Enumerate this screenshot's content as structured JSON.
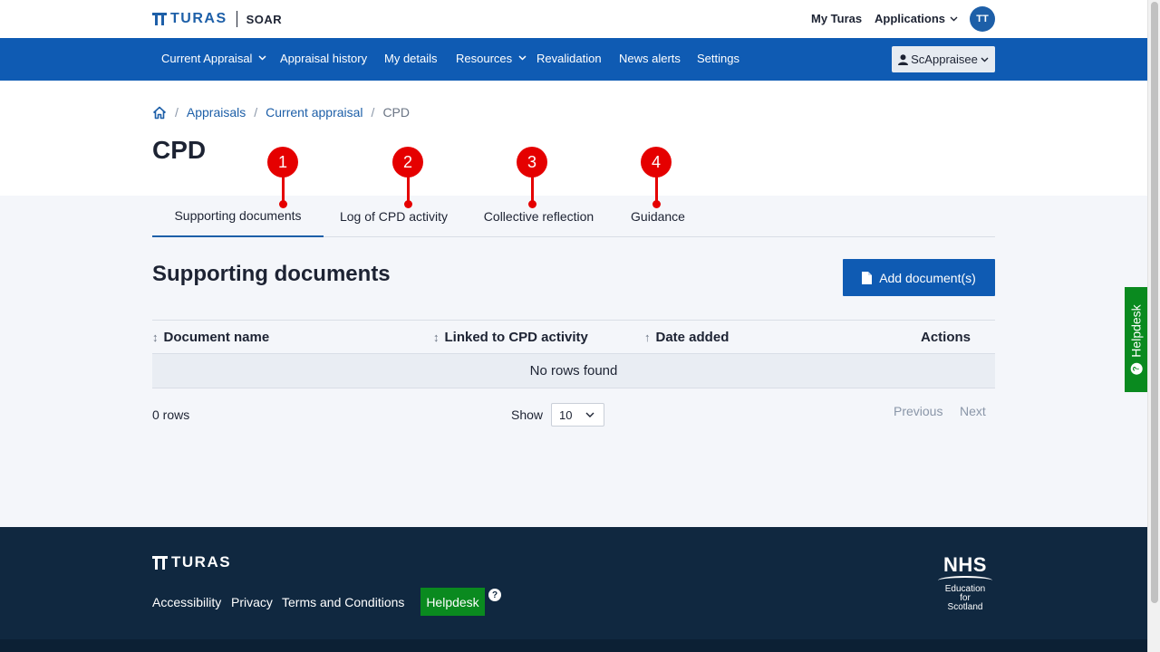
{
  "header": {
    "logo_text": "TURAS",
    "app_name": "SOAR",
    "my_turas": "My Turas",
    "applications": "Applications",
    "avatar_initials": "TT"
  },
  "nav": {
    "items": [
      {
        "label": "Current Appraisal",
        "dropdown": true
      },
      {
        "label": "Appraisal history",
        "dropdown": false
      },
      {
        "label": "My details",
        "dropdown": false
      },
      {
        "label": "Resources",
        "dropdown": true
      },
      {
        "label": "Revalidation",
        "dropdown": false
      },
      {
        "label": "News alerts",
        "dropdown": false
      },
      {
        "label": "Settings",
        "dropdown": false
      }
    ],
    "user_menu": "ScAppraisee"
  },
  "breadcrumb": {
    "items": [
      "Appraisals",
      "Current appraisal"
    ],
    "current": "CPD"
  },
  "page_title": "CPD",
  "tabs": [
    {
      "label": "Supporting documents",
      "active": true,
      "marker": "1"
    },
    {
      "label": "Log of CPD activity",
      "active": false,
      "marker": "2"
    },
    {
      "label": "Collective reflection",
      "active": false,
      "marker": "3"
    },
    {
      "label": "Guidance",
      "active": false,
      "marker": "4"
    }
  ],
  "section": {
    "title": "Supporting documents",
    "add_button": "Add document(s)"
  },
  "table": {
    "columns": [
      "Document name",
      "Linked to CPD activity",
      "Date added",
      "Actions"
    ],
    "empty_message": "No rows found"
  },
  "pagination": {
    "row_count": "0 rows",
    "show_label": "Show",
    "page_size": "10",
    "previous": "Previous",
    "next": "Next"
  },
  "footer": {
    "logo_text": "TURAS",
    "links": [
      "Accessibility",
      "Privacy",
      "Terms and Conditions"
    ],
    "helpdesk": "Helpdesk",
    "help_badge": "?",
    "nhs": "NHS",
    "nhs_lines": [
      "Education",
      "for",
      "Scotland"
    ]
  },
  "side_helpdesk": "Helpdesk",
  "colors": {
    "primary": "#0f5bb3",
    "footer": "#102840",
    "helpdesk_green": "#0a8a1f",
    "marker_red": "#e50000"
  }
}
